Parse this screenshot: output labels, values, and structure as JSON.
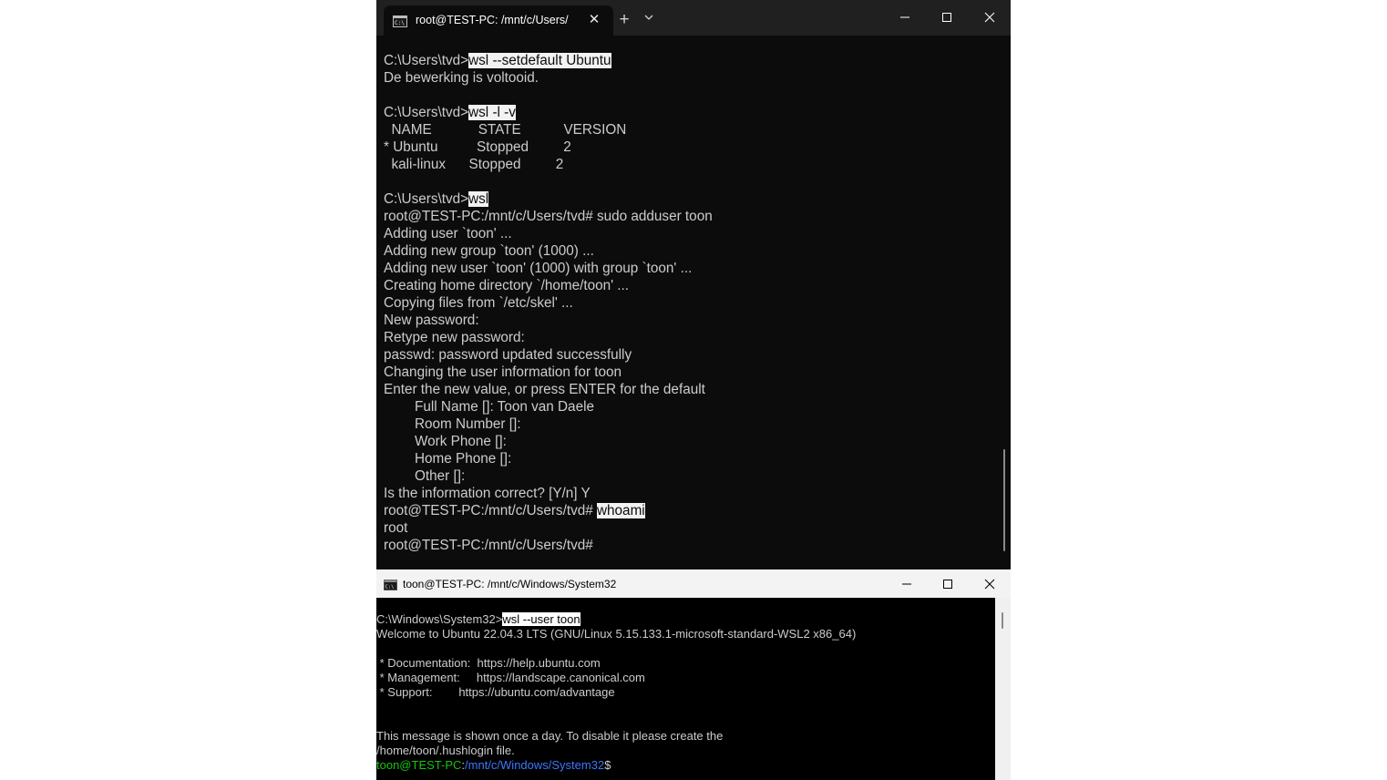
{
  "terminal": {
    "tab_title": "root@TEST-PC: /mnt/c/Users/",
    "new_tab_symbol": "+",
    "close_tab_symbol": "✕",
    "lines": [
      {
        "prompt": "C:\\Users\\tvd>",
        "cmd": "wsl --setdefault Ubuntu"
      },
      {
        "text": "De bewerking is voltooid."
      },
      {
        "text": ""
      },
      {
        "prompt": "C:\\Users\\tvd>",
        "cmd": "wsl -l -v"
      },
      {
        "text": "  NAME            STATE           VERSION"
      },
      {
        "text": "* Ubuntu          Stopped         2"
      },
      {
        "text": "  kali-linux      Stopped         2"
      },
      {
        "text": ""
      },
      {
        "prompt": "C:\\Users\\tvd>",
        "cmd": "wsl"
      },
      {
        "text": "root@TEST-PC:/mnt/c/Users/tvd# sudo adduser toon"
      },
      {
        "text": "Adding user `toon' ..."
      },
      {
        "text": "Adding new group `toon' (1000) ..."
      },
      {
        "text": "Adding new user `toon' (1000) with group `toon' ..."
      },
      {
        "text": "Creating home directory `/home/toon' ..."
      },
      {
        "text": "Copying files from `/etc/skel' ..."
      },
      {
        "text": "New password:"
      },
      {
        "text": "Retype new password:"
      },
      {
        "text": "passwd: password updated successfully"
      },
      {
        "text": "Changing the user information for toon"
      },
      {
        "text": "Enter the new value, or press ENTER for the default"
      },
      {
        "text": "        Full Name []: Toon van Daele"
      },
      {
        "text": "        Room Number []:"
      },
      {
        "text": "        Work Phone []:"
      },
      {
        "text": "        Home Phone []:"
      },
      {
        "text": "        Other []:"
      },
      {
        "text": "Is the information correct? [Y/n] Y"
      },
      {
        "prompt": "root@TEST-PC:/mnt/c/Users/tvd# ",
        "cmd": "whoami"
      },
      {
        "text": "root"
      },
      {
        "text": "root@TEST-PC:/mnt/c/Users/tvd#"
      }
    ]
  },
  "console": {
    "title": "toon@TEST-PC: /mnt/c/Windows/System32",
    "lines": [
      {
        "prompt": "C:\\Windows\\System32>",
        "cmd": "wsl --user toon"
      },
      {
        "text": "Welcome to Ubuntu 22.04.3 LTS (GNU/Linux 5.15.133.1-microsoft-standard-WSL2 x86_64)"
      },
      {
        "text": ""
      },
      {
        "text": " * Documentation:  https://help.ubuntu.com"
      },
      {
        "text": " * Management:     https://landscape.canonical.com"
      },
      {
        "text": " * Support:        https://ubuntu.com/advantage"
      },
      {
        "text": ""
      },
      {
        "text": ""
      },
      {
        "text": "This message is shown once a day. To disable it please create the"
      },
      {
        "text": "/home/toon/.hushlogin file."
      }
    ],
    "final_prompt": {
      "user": "toon@TEST-PC",
      "sep": ":",
      "path": "/mnt/c/Windows/System32",
      "end": "$"
    }
  },
  "colors": {
    "terminal_bg": "#0c0c0c",
    "titlebar_bg": "#202020",
    "text": "#cccccc",
    "prompt_green": "#16c60c",
    "path_blue": "#3b78ff"
  }
}
